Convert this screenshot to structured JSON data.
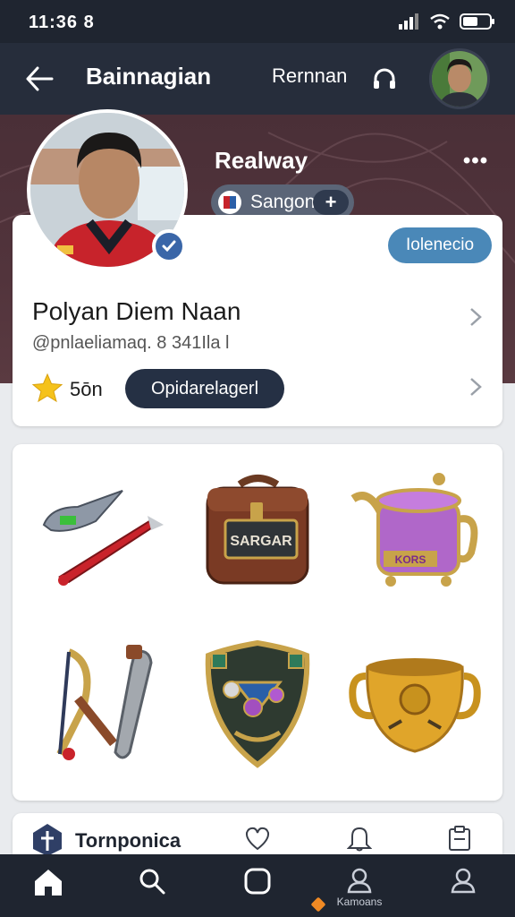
{
  "status_bar": {
    "time": "11:36 8"
  },
  "app_bar": {
    "title": "Bainnagian",
    "action_label": "Rernnan"
  },
  "profile": {
    "display_name": "Realway",
    "chip_label": "Sangon",
    "chip_plus": "+",
    "follow_label": "Iolenecio",
    "full_name": "Polyan Diem Naan",
    "handle": "@pnlaeliamaq. 8 341Ila l",
    "rating": "5ōn",
    "pill_label": "Opidarelagerl"
  },
  "items": [
    {
      "icon": "blade-dagger-icon"
    },
    {
      "icon": "leather-bag-icon",
      "label": "SARGAR"
    },
    {
      "icon": "purple-teapot-icon",
      "label": "KORS"
    },
    {
      "icon": "bow-wrench-icon"
    },
    {
      "icon": "crest-shield-icon"
    },
    {
      "icon": "golden-cauldron-icon"
    }
  ],
  "section": {
    "title": "Tornponica"
  },
  "bottom_nav": {
    "badge_label": "Kamoans"
  },
  "colors": {
    "accent": "#4a88b8",
    "dark": "#253044",
    "banner": "#4a2f37",
    "nav": "#1f2530"
  }
}
